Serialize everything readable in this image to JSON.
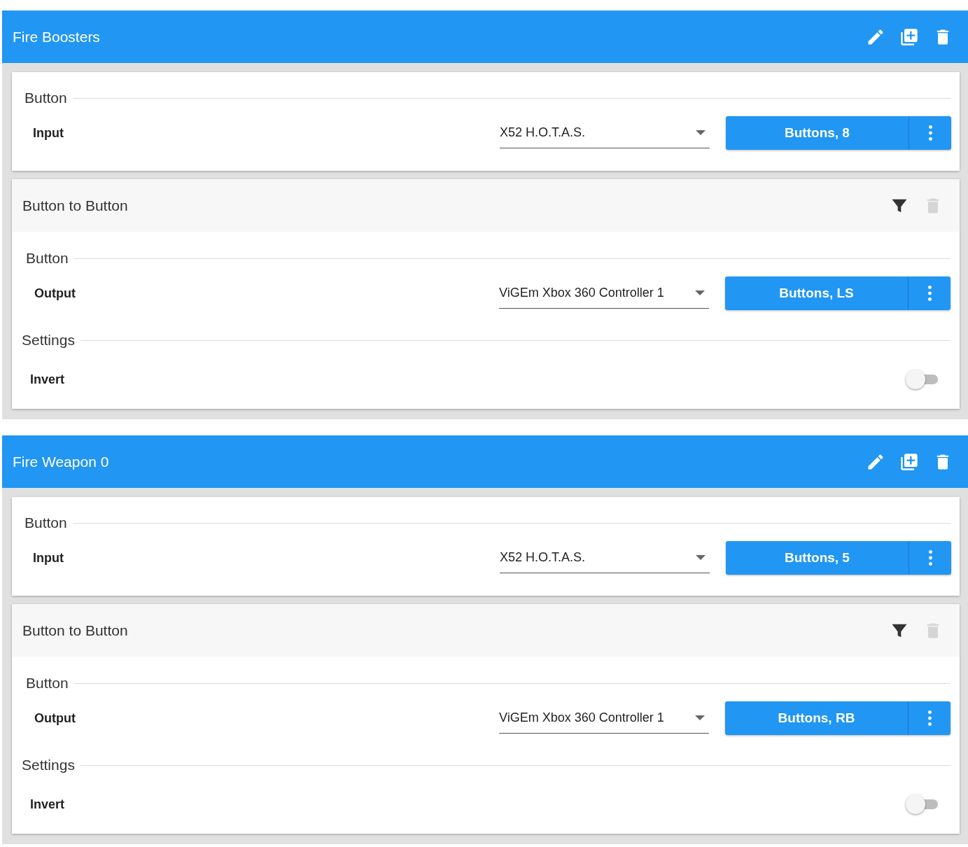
{
  "groups": [
    {
      "title": "Fire Boosters",
      "input": {
        "section": "Button",
        "label": "Input",
        "device": "X52 H.O.T.A.S.",
        "binding": "Buttons, 8"
      },
      "plugins": [
        {
          "title": "Button to Button",
          "delete_disabled": true,
          "output": {
            "section": "Button",
            "label": "Output",
            "device": "ViGEm Xbox 360 Controller 1",
            "binding": "Buttons, LS"
          },
          "settings": {
            "heading": "Settings",
            "items": [
              {
                "label": "Invert",
                "on": false
              }
            ]
          }
        }
      ]
    },
    {
      "title": "Fire Weapon 0",
      "input": {
        "section": "Button",
        "label": "Input",
        "device": "X52 H.O.T.A.S.",
        "binding": "Buttons, 5"
      },
      "plugins": [
        {
          "title": "Button to Button",
          "delete_disabled": true,
          "output": {
            "section": "Button",
            "label": "Output",
            "device": "ViGEm Xbox 360 Controller 1",
            "binding": "Buttons, RB"
          },
          "settings": {
            "heading": "Settings",
            "items": [
              {
                "label": "Invert",
                "on": false
              }
            ]
          }
        }
      ]
    }
  ]
}
